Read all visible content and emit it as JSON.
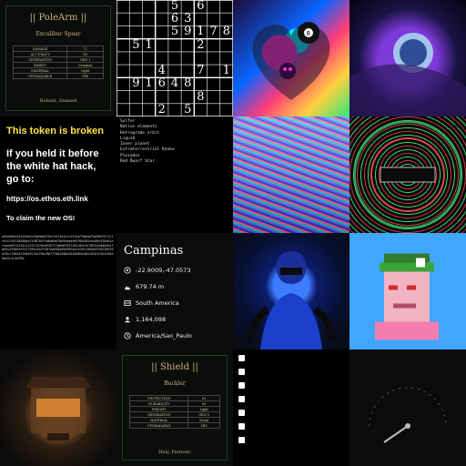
{
  "polearm": {
    "title": "|| PoleArm ||",
    "subtitle": "Excalibur Spear",
    "rows": [
      [
        "DAMAGE",
        "72"
      ],
      [
        "ACCURACY",
        "85"
      ],
      [
        "GENERATION",
        "GEN 1"
      ],
      [
        "RARITY",
        "Common"
      ],
      [
        "MATERIAL",
        "Light"
      ],
      [
        "UPGRADABLE",
        "YES"
      ]
    ],
    "footer": "Robust, Stained"
  },
  "sudoku": {
    "cells": [
      {
        "r": 0,
        "c": 4,
        "v": "5"
      },
      {
        "r": 0,
        "c": 6,
        "v": "6"
      },
      {
        "r": 1,
        "c": 4,
        "v": "6"
      },
      {
        "r": 1,
        "c": 5,
        "v": "3"
      },
      {
        "r": 2,
        "c": 4,
        "v": "5"
      },
      {
        "r": 2,
        "c": 5,
        "v": "9"
      },
      {
        "r": 2,
        "c": 6,
        "v": "1"
      },
      {
        "r": 2,
        "c": 7,
        "v": "7"
      },
      {
        "r": 2,
        "c": 8,
        "v": "8"
      },
      {
        "r": 3,
        "c": 1,
        "v": "5"
      },
      {
        "r": 3,
        "c": 2,
        "v": "1"
      },
      {
        "r": 3,
        "c": 6,
        "v": "2"
      },
      {
        "r": 5,
        "c": 3,
        "v": "4"
      },
      {
        "r": 5,
        "c": 6,
        "v": "7"
      },
      {
        "r": 5,
        "c": 8,
        "v": "1"
      },
      {
        "r": 6,
        "c": 1,
        "v": "9"
      },
      {
        "r": 6,
        "c": 2,
        "v": "1"
      },
      {
        "r": 6,
        "c": 3,
        "v": "6"
      },
      {
        "r": 6,
        "c": 4,
        "v": "4"
      },
      {
        "r": 6,
        "c": 5,
        "v": "8"
      },
      {
        "r": 7,
        "c": 6,
        "v": "8"
      },
      {
        "r": 8,
        "c": 3,
        "v": "2"
      },
      {
        "r": 8,
        "c": 5,
        "v": "5"
      }
    ]
  },
  "token": {
    "warning": "This token is broken",
    "line1": "If you held it before the white hat hack, go to:",
    "link": "https://os.ethos.eth.link",
    "claim": "To claim the new OS!"
  },
  "terminal": {
    "lines": [
      "Sulfer",
      "Native elements",
      "Retrograde orbit",
      "Liquid",
      "Inner planet",
      "Extraterrestrial Konka",
      "Pleiades",
      "Red Dwarf Star"
    ]
  },
  "hex": {
    "text": "e64d48d4451616e5c5b69b8475e1fd74d1efc3f34e79b04d7ae9b9797121fa1c3f011856dbc74487a57cd6a6a670b5ebae00798d364cac00c918eb1ef4eee0512134c1c2317b7dc0549717a6d07817a9140d7ef20fe2e8ab82e7b65c2b3b0fe1e7749e2ea7f4d7ee04ed05e96fbcce29fc9e4ee5fbc3b0f0af0ccf40e4ffd6e9f3ecf6b19b7f7d8c6d8ed2a6d04a4b1c81bfc3e1e3be0ea2c1c4d78b"
  },
  "geo": {
    "city": "Campinas",
    "coords": "-22.9009,-47.0573",
    "elevation": "679.74 m",
    "continent": "South America",
    "population": "1,164,098",
    "timezone": "America/Sao_Paulo"
  },
  "shield": {
    "title": "|| Shield ||",
    "subtitle": "Buckler",
    "rows": [
      [
        "PROTECTION",
        "63"
      ],
      [
        "DURABILITY",
        "85"
      ],
      [
        "WEIGHT",
        "Light"
      ],
      [
        "GENERATION",
        "GEN 0"
      ],
      [
        "MATERIAL",
        "Metal"
      ],
      [
        "UPGRADABLE",
        "YES"
      ]
    ],
    "footer": "Holy, Patriotic"
  },
  "colors": {
    "card_gold": "#d6c88a",
    "token_yellow": "#ffe34d"
  }
}
